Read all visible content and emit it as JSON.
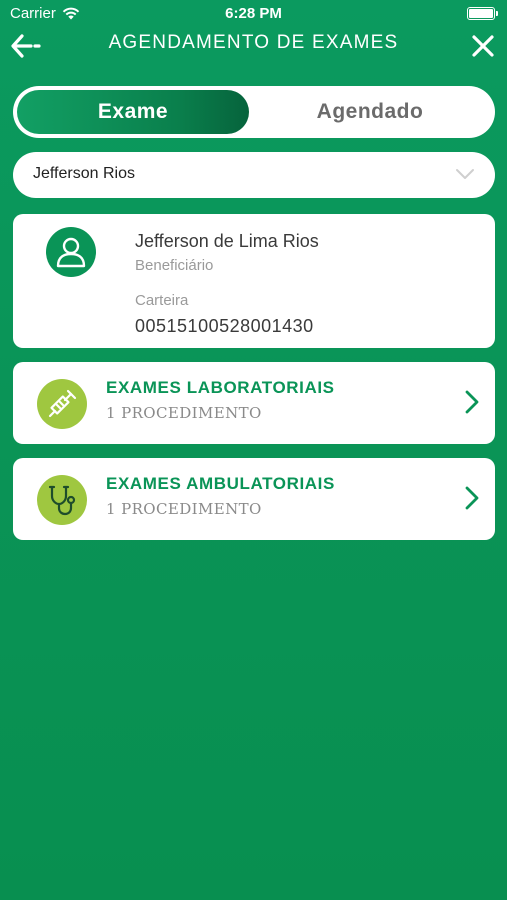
{
  "status_bar": {
    "carrier": "Carrier",
    "time": "6:28 PM",
    "icons": [
      "wifi-icon",
      "battery-icon"
    ]
  },
  "nav": {
    "title": "AGENDAMENTO DE EXAMES",
    "back_icon": "back-arrow-icon",
    "close_icon": "close-icon"
  },
  "tabs": [
    {
      "label": "Exame",
      "active": true
    },
    {
      "label": "Agendado",
      "active": false
    }
  ],
  "beneficiary_select": {
    "selected": "Jefferson Rios"
  },
  "profile": {
    "name": "Jefferson de Lima Rios",
    "role": "Beneficiário",
    "card_label": "Carteira",
    "card_number": "00515100528001430"
  },
  "exams": [
    {
      "title": "EXAMES LABORATORIAIS",
      "subtitle": "1 PROCEDIMENTO",
      "icon": "syringe-icon"
    },
    {
      "title": "EXAMES AMBULATORIAIS",
      "subtitle": "1 PROCEDIMENTO",
      "icon": "stethoscope-icon"
    }
  ],
  "colors": {
    "background": "#0a9457",
    "accent": "#0a9457",
    "icon_circle": "#9fc740",
    "card": "#ffffff"
  }
}
